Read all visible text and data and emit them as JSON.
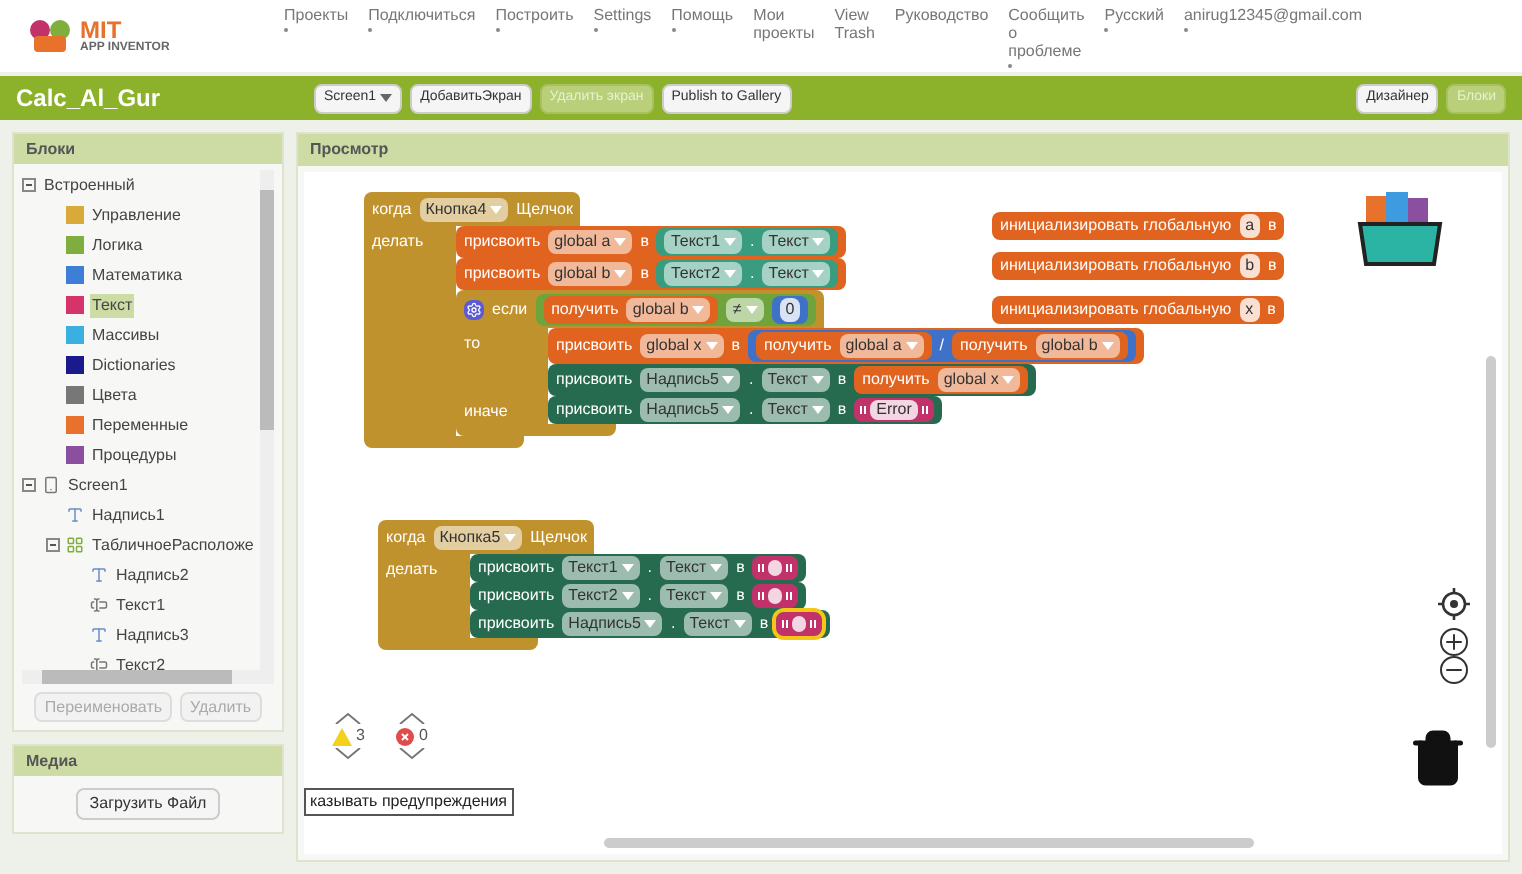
{
  "logo": {
    "title": "MIT",
    "subtitle": "APP INVENTOR"
  },
  "menu": [
    {
      "label": "Проекты",
      "dropdown": true
    },
    {
      "label": "Подключиться",
      "dropdown": true
    },
    {
      "label": "Построить",
      "dropdown": true
    },
    {
      "label": "Settings",
      "dropdown": true
    },
    {
      "label": "Помощь",
      "dropdown": true
    },
    {
      "label": "Мои проекты",
      "dropdown": false
    },
    {
      "label": "View Trash",
      "dropdown": false
    },
    {
      "label": "Руководство",
      "dropdown": false
    },
    {
      "label": "Сообщить о проблеме",
      "dropdown": true
    },
    {
      "label": "Русский",
      "dropdown": true
    },
    {
      "label": "anirug12345@gmail.com",
      "dropdown": true
    }
  ],
  "project": {
    "title": "Calc_Al_Gur",
    "buttons": [
      {
        "label": "Screen1",
        "dropdown": true,
        "disabled": false
      },
      {
        "label": "ДобавитьЭкран",
        "dropdown": false,
        "disabled": false
      },
      {
        "label": "Удалить экран",
        "dropdown": false,
        "disabled": true
      },
      {
        "label": "Publish to Gallery",
        "dropdown": false,
        "disabled": false
      }
    ],
    "views": [
      {
        "label": "Дизайнер",
        "selected": false
      },
      {
        "label": "Блоки",
        "selected": true
      }
    ]
  },
  "sidebar": {
    "title": "Блоки",
    "tree": [
      {
        "label": "Встроенный",
        "kind": "folder",
        "expanded": true,
        "children": [
          {
            "label": "Управление",
            "kind": "category",
            "color": "#d9a93a",
            "selected": false
          },
          {
            "label": "Логика",
            "kind": "category",
            "color": "#7fae3e",
            "selected": false
          },
          {
            "label": "Математика",
            "kind": "category",
            "color": "#3f7ed6",
            "selected": false
          },
          {
            "label": "Текст",
            "kind": "category",
            "color": "#d6336b",
            "selected": true
          },
          {
            "label": "Массивы",
            "kind": "category",
            "color": "#3ab0e0",
            "selected": false
          },
          {
            "label": "Dictionaries",
            "kind": "category",
            "color": "#1a1a8c",
            "selected": false
          },
          {
            "label": "Цвета",
            "kind": "category",
            "color": "#777777",
            "selected": false
          },
          {
            "label": "Переменные",
            "kind": "category",
            "color": "#e8712b",
            "selected": false
          },
          {
            "label": "Процедуры",
            "kind": "category",
            "color": "#8a4f9e",
            "selected": false
          }
        ]
      },
      {
        "label": "Screen1",
        "kind": "screen",
        "expanded": true,
        "children": [
          {
            "label": "Надпись1",
            "kind": "label"
          },
          {
            "label": "ТабличноеРасположе",
            "kind": "table",
            "expanded": true,
            "children": [
              {
                "label": "Надпись2",
                "kind": "label"
              },
              {
                "label": "Текст1",
                "kind": "textbox"
              },
              {
                "label": "Надпись3",
                "kind": "label"
              },
              {
                "label": "Текст2",
                "kind": "textbox"
              }
            ]
          }
        ]
      }
    ],
    "buttons": [
      {
        "label": "Переименовать"
      },
      {
        "label": "Удалить"
      }
    ]
  },
  "media": {
    "title": "Медиа",
    "button": "Загрузить Файл"
  },
  "viewer": {
    "title": "Просмотр",
    "blocks": [
      {
        "kind": "event",
        "tokens": [
          {
            "kind": "label",
            "text": "когда"
          },
          {
            "kind": "dropdown",
            "text": "Кнопка4"
          },
          {
            "kind": "label",
            "text": "Щелчок"
          }
        ],
        "sections": [
          {
            "label": "делать",
            "statements": [
              {
                "kind": "set_var",
                "tokens": [
                  {
                    "kind": "label",
                    "text": "присвоить"
                  },
                  {
                    "kind": "dropdown",
                    "text": "global a"
                  },
                  {
                    "kind": "label",
                    "text": "в"
                  },
                  {
                    "kind": "block",
                    "block": {
                      "kind": "component_get",
                      "tokens": [
                        {
                          "kind": "dropdown",
                          "text": "Текст1"
                        },
                        {
                          "kind": "label",
                          "text": "."
                        },
                        {
                          "kind": "dropdown",
                          "text": "Текст"
                        }
                      ]
                    }
                  }
                ]
              },
              {
                "kind": "set_var",
                "tokens": [
                  {
                    "kind": "label",
                    "text": "присвоить"
                  },
                  {
                    "kind": "dropdown",
                    "text": "global b"
                  },
                  {
                    "kind": "label",
                    "text": "в"
                  },
                  {
                    "kind": "block",
                    "block": {
                      "kind": "component_get",
                      "tokens": [
                        {
                          "kind": "dropdown",
                          "text": "Текст2"
                        },
                        {
                          "kind": "label",
                          "text": "."
                        },
                        {
                          "kind": "dropdown",
                          "text": "Текст"
                        }
                      ]
                    }
                  }
                ]
              },
              {
                "kind": "if",
                "tokens": [
                  {
                    "kind": "label",
                    "text": "если"
                  },
                  {
                    "kind": "block",
                    "block": {
                      "kind": "compare",
                      "tokens": [
                        {
                          "kind": "block",
                          "block": {
                            "kind": "get_var",
                            "tokens": [
                              {
                                "kind": "label",
                                "text": "получить"
                              },
                              {
                                "kind": "dropdown",
                                "text": "global b"
                              }
                            ]
                          }
                        },
                        {
                          "kind": "dropdown",
                          "text": "≠"
                        },
                        {
                          "kind": "block",
                          "block": {
                            "kind": "number",
                            "tokens": [
                              {
                                "kind": "field",
                                "text": "0"
                              }
                            ]
                          }
                        }
                      ]
                    }
                  }
                ],
                "sections": [
                  {
                    "label": "то",
                    "statements": [
                      {
                        "kind": "set_var",
                        "tokens": [
                          {
                            "kind": "label",
                            "text": "присвоить"
                          },
                          {
                            "kind": "dropdown",
                            "text": "global x"
                          },
                          {
                            "kind": "label",
                            "text": "в"
                          },
                          {
                            "kind": "block",
                            "block": {
                              "kind": "divide",
                              "tokens": [
                                {
                                  "kind": "block",
                                  "block": {
                                    "kind": "get_var",
                                    "tokens": [
                                      {
                                        "kind": "label",
                                        "text": "получить"
                                      },
                                      {
                                        "kind": "dropdown",
                                        "text": "global a"
                                      }
                                    ]
                                  }
                                },
                                {
                                  "kind": "label",
                                  "text": "/"
                                },
                                {
                                  "kind": "block",
                                  "block": {
                                    "kind": "get_var",
                                    "tokens": [
                                      {
                                        "kind": "label",
                                        "text": "получить"
                                      },
                                      {
                                        "kind": "dropdown",
                                        "text": "global b"
                                      }
                                    ]
                                  }
                                }
                              ]
                            }
                          }
                        ]
                      },
                      {
                        "kind": "component_set",
                        "tokens": [
                          {
                            "kind": "label",
                            "text": "присвоить"
                          },
                          {
                            "kind": "dropdown",
                            "text": "Надпись5"
                          },
                          {
                            "kind": "label",
                            "text": "."
                          },
                          {
                            "kind": "dropdown",
                            "text": "Текст"
                          },
                          {
                            "kind": "label",
                            "text": "в"
                          },
                          {
                            "kind": "block",
                            "block": {
                              "kind": "get_var",
                              "tokens": [
                                {
                                  "kind": "label",
                                  "text": "получить"
                                },
                                {
                                  "kind": "dropdown",
                                  "text": "global x"
                                }
                              ]
                            }
                          }
                        ]
                      }
                    ]
                  },
                  {
                    "label": "иначе",
                    "statements": [
                      {
                        "kind": "component_set",
                        "tokens": [
                          {
                            "kind": "label",
                            "text": "присвоить"
                          },
                          {
                            "kind": "dropdown",
                            "text": "Надпись5"
                          },
                          {
                            "kind": "label",
                            "text": "."
                          },
                          {
                            "kind": "dropdown",
                            "text": "Текст"
                          },
                          {
                            "kind": "label",
                            "text": "в"
                          },
                          {
                            "kind": "block",
                            "block": {
                              "kind": "text",
                              "value": "Error"
                            }
                          }
                        ]
                      }
                    ]
                  }
                ]
              }
            ]
          }
        ]
      },
      {
        "kind": "event",
        "tokens": [
          {
            "kind": "label",
            "text": "когда"
          },
          {
            "kind": "dropdown",
            "text": "Кнопка5"
          },
          {
            "kind": "label",
            "text": "Щелчок"
          }
        ],
        "sections": [
          {
            "label": "делать",
            "statements": [
              {
                "kind": "component_set",
                "tokens": [
                  {
                    "kind": "label",
                    "text": "присвоить"
                  },
                  {
                    "kind": "dropdown",
                    "text": "Текст1"
                  },
                  {
                    "kind": "label",
                    "text": "."
                  },
                  {
                    "kind": "dropdown",
                    "text": "Текст"
                  },
                  {
                    "kind": "label",
                    "text": "в"
                  },
                  {
                    "kind": "block",
                    "block": {
                      "kind": "text"
                    }
                  }
                ]
              },
              {
                "kind": "component_set",
                "tokens": [
                  {
                    "kind": "label",
                    "text": "присвоить"
                  },
                  {
                    "kind": "dropdown",
                    "text": "Текст2"
                  },
                  {
                    "kind": "label",
                    "text": "."
                  },
                  {
                    "kind": "dropdown",
                    "text": "Текст"
                  },
                  {
                    "kind": "label",
                    "text": "в"
                  },
                  {
                    "kind": "block",
                    "block": {
                      "kind": "text"
                    }
                  }
                ]
              },
              {
                "kind": "component_set",
                "tokens": [
                  {
                    "kind": "label",
                    "text": "присвоить"
                  },
                  {
                    "kind": "dropdown",
                    "text": "Надпись5"
                  },
                  {
                    "kind": "label",
                    "text": "."
                  },
                  {
                    "kind": "dropdown",
                    "text": "Текст"
                  },
                  {
                    "kind": "label",
                    "text": "в"
                  },
                  {
                    "kind": "block",
                    "block": {
                      "kind": "text",
                      "selected": true
                    }
                  }
                ]
              }
            ]
          }
        ]
      },
      {
        "kind": "init_global",
        "tokens": [
          {
            "kind": "label",
            "text": "инициализировать глобальную"
          },
          {
            "kind": "field",
            "text": "a"
          },
          {
            "kind": "label",
            "text": "в"
          }
        ]
      },
      {
        "kind": "init_global",
        "tokens": [
          {
            "kind": "label",
            "text": "инициализировать глобальную"
          },
          {
            "kind": "field",
            "text": "b"
          },
          {
            "kind": "label",
            "text": "в"
          }
        ]
      },
      {
        "kind": "init_global",
        "tokens": [
          {
            "kind": "label",
            "text": "инициализировать глобальную"
          },
          {
            "kind": "field",
            "text": "x"
          },
          {
            "kind": "label",
            "text": "в"
          }
        ]
      }
    ],
    "warnings": "3",
    "errors": "0",
    "warning_toggle": "казывать предупреждения"
  }
}
